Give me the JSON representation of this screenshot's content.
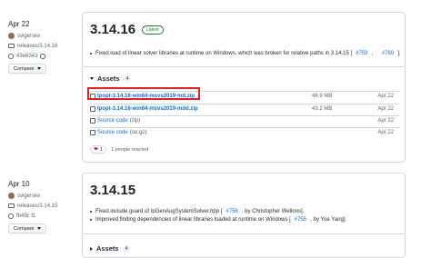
{
  "releases": [
    {
      "date": "Apr 22",
      "author": "svigerske",
      "tag": "releases/3.14.16",
      "commit": "43e6343",
      "compare_label": "Compare",
      "title": "3.14.16",
      "badge": "Latest",
      "notes": [
        {
          "text": "Fixed load of linear solver libraries at runtime on Windows, which was broken for relative paths in 3.14.15 [",
          "links": [
            "#759",
            "#760"
          ],
          "end": "]."
        }
      ],
      "assets_label": "Assets",
      "assets_count": "4",
      "assets": [
        {
          "name": "Ipopt-3.14.16-win64-msvs2019-md.zip",
          "size": "48.9 MB",
          "date": "Apr 22"
        },
        {
          "name": "Ipopt-3.14.16-win64-msvs2019-mdd.zip",
          "size": "43.2 MB",
          "date": "Apr 22"
        },
        {
          "name": "Source code",
          "suffix": "(zip)",
          "date": "Apr 22"
        },
        {
          "name": "Source code",
          "suffix": "(tar.gz)",
          "date": "Apr 22"
        }
      ],
      "reaction_emoji": "❤",
      "reaction_count": "1",
      "reaction_text": "1 people reacted"
    },
    {
      "date": "Apr 10",
      "author": "svigerske",
      "tag": "releases/3.14.15",
      "commit": "fb49c f1",
      "compare_label": "Compare",
      "title": "3.14.15",
      "notes": [
        {
          "text": "Fixed include guard of IpGenAugSystemSolver.hpp [",
          "link": "#756",
          "end": ", by Christopher Wellons]."
        },
        {
          "text": "Improved finding dependencies of linear libraries loaded at runtime on Windows [",
          "link": "#755",
          "end": ", by Yue Yang]."
        }
      ],
      "assets_label": "Assets",
      "assets_count": "4"
    }
  ],
  "colors": {
    "link": "#0969da",
    "latest": "#1a7f37",
    "highlight": "#e02020",
    "heart": "#cf222e"
  }
}
